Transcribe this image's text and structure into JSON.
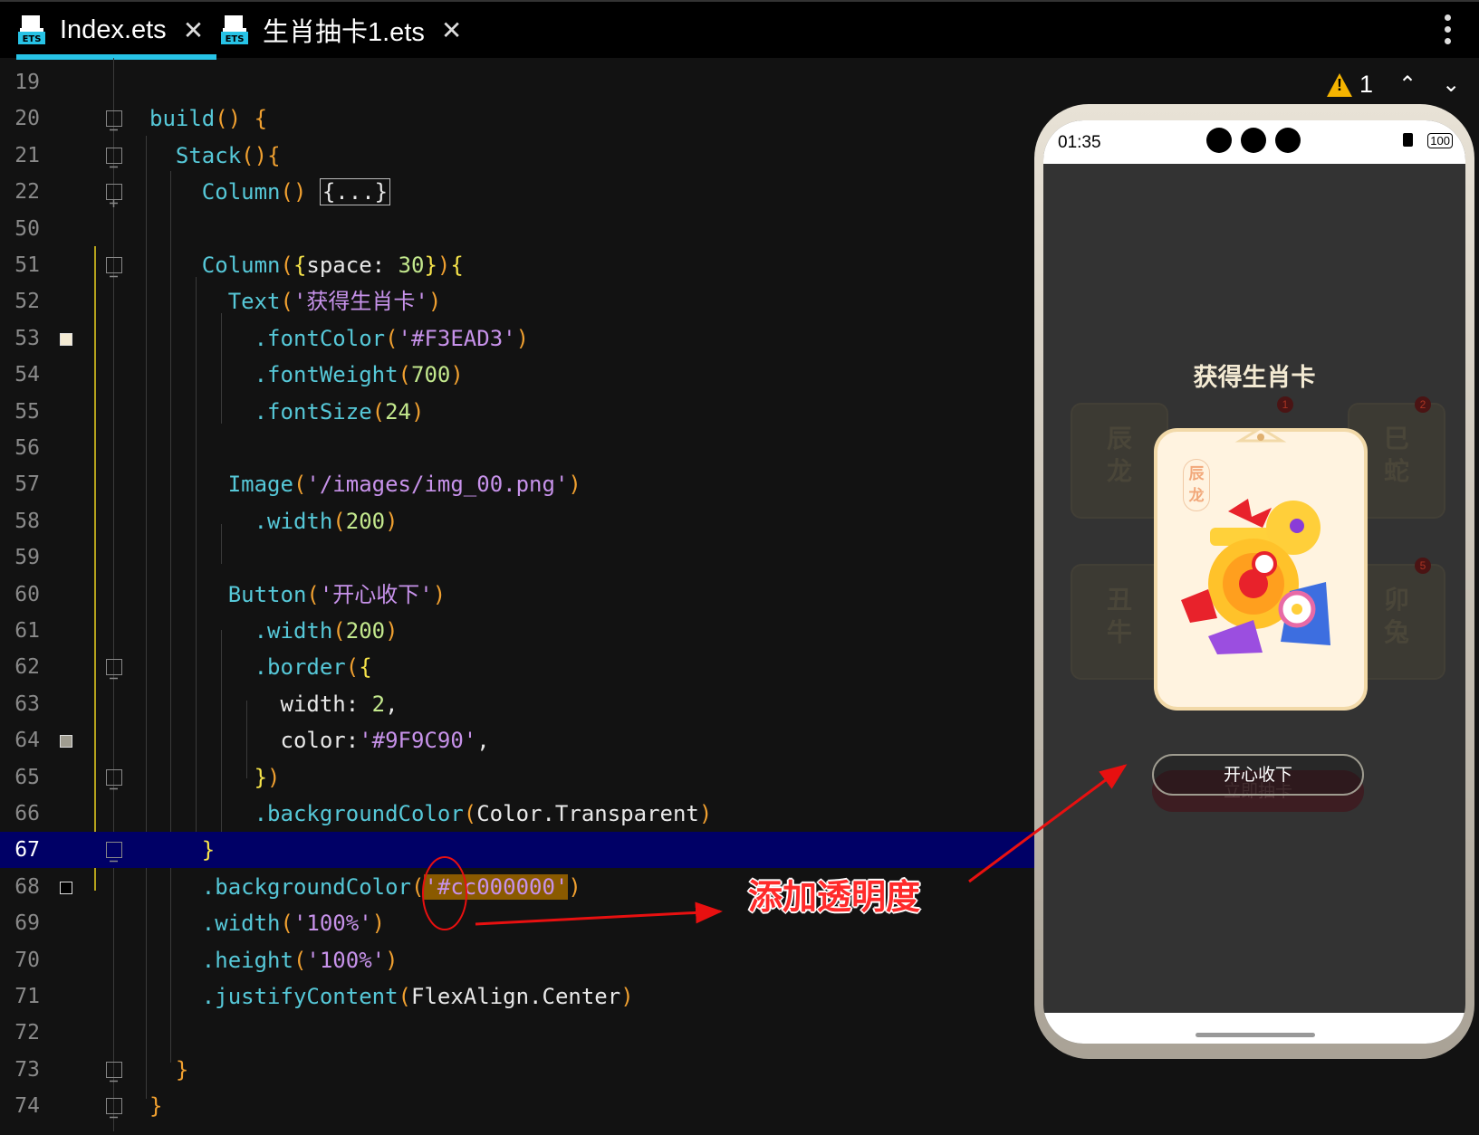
{
  "tabs": [
    {
      "label": "Index.ets",
      "active": true
    },
    {
      "label": "生肖抽卡1.ets",
      "active": false
    }
  ],
  "inspection": {
    "warning_count": "1"
  },
  "code_lines": [
    {
      "num": "19",
      "html": ""
    },
    {
      "num": "20",
      "html": "<span class='fn'>build</span><span class='br'>()</span> <span class='br'>{</span>"
    },
    {
      "num": "21",
      "html": "  <span class='fn'>Stack</span><span class='br'>()</span><span class='br'>{</span>"
    },
    {
      "num": "22",
      "html": "    <span class='fn'>Column</span><span class='br'>()</span> <span class='fold-box'>{...}</span>"
    },
    {
      "num": "50",
      "html": ""
    },
    {
      "num": "51",
      "html": "    <span class='fn'>Column</span><span class='br'>(</span><span class='br2'>{</span>space: <span class='num'>30</span><span class='br2'>}</span><span class='br'>)</span><span class='br2'>{</span>"
    },
    {
      "num": "52",
      "html": "      <span class='fn'>Text</span><span class='br'>(</span><span class='str'>'获得生肖卡'</span><span class='br'>)</span>"
    },
    {
      "num": "53",
      "html": "        <span class='fn'>.fontColor</span><span class='br'>(</span><span class='str'>'#F3EAD3'</span><span class='br'>)</span>"
    },
    {
      "num": "54",
      "html": "        <span class='fn'>.fontWeight</span><span class='br'>(</span><span class='num'>700</span><span class='br'>)</span>"
    },
    {
      "num": "55",
      "html": "        <span class='fn'>.fontSize</span><span class='br'>(</span><span class='num'>24</span><span class='br'>)</span>"
    },
    {
      "num": "56",
      "html": ""
    },
    {
      "num": "57",
      "html": "      <span class='fn'>Image</span><span class='br'>(</span><span class='str'>'/images/img_00.png'</span><span class='br'>)</span>"
    },
    {
      "num": "58",
      "html": "        <span class='fn'>.width</span><span class='br'>(</span><span class='num'>200</span><span class='br'>)</span>"
    },
    {
      "num": "59",
      "html": ""
    },
    {
      "num": "60",
      "html": "      <span class='fn'>Button</span><span class='br'>(</span><span class='str'>'开心收下'</span><span class='br'>)</span>"
    },
    {
      "num": "61",
      "html": "        <span class='fn'>.width</span><span class='br'>(</span><span class='num'>200</span><span class='br'>)</span>"
    },
    {
      "num": "62",
      "html": "        <span class='fn'>.border</span><span class='br'>(</span><span class='br2'>{</span>"
    },
    {
      "num": "63",
      "html": "          width: <span class='num'>2</span>,"
    },
    {
      "num": "64",
      "html": "          color:<span class='str'>'#9F9C90'</span>,"
    },
    {
      "num": "65",
      "html": "        <span class='br2'>}</span><span class='br'>)</span>"
    },
    {
      "num": "66",
      "html": "        <span class='fn'>.backgroundColor</span><span class='br'>(</span>Color.Transparent<span class='br'>)</span>"
    },
    {
      "num": "67",
      "html": "    <span class='br2'>}</span>"
    },
    {
      "num": "68",
      "html": "    <span class='fn'>.backgroundColor</span><span class='br'>(</span><span class='hlstr'><span class='str'>'#cc000000'</span></span><span class='br'>)</span>"
    },
    {
      "num": "69",
      "html": "    <span class='fn'>.width</span><span class='br'>(</span><span class='str'>'100%'</span><span class='br'>)</span>"
    },
    {
      "num": "70",
      "html": "    <span class='fn'>.height</span><span class='br'>(</span><span class='str'>'100%'</span><span class='br'>)</span>"
    },
    {
      "num": "71",
      "html": "    <span class='fn'>.justifyContent</span><span class='br'>(</span>FlexAlign.Center<span class='br'>)</span>"
    },
    {
      "num": "72",
      "html": ""
    },
    {
      "num": "73",
      "html": "  <span class='br'>}</span>"
    },
    {
      "num": "74",
      "html": "<span class='br'>}</span>"
    }
  ],
  "highlighted_line": "67",
  "phone": {
    "time": "01:35",
    "battery": "100",
    "title": "获得生肖卡",
    "card_seal": "辰龙",
    "button_label": "开心收下",
    "ghost_button_label": "立即抽卡",
    "ghost_cards": [
      {
        "text": "辰龙",
        "badge": "1"
      },
      {
        "text": "巳蛇",
        "badge": "2"
      },
      {
        "text": "丑牛",
        "badge": ""
      },
      {
        "text": "卯兔",
        "badge": "5"
      }
    ]
  },
  "annotation": {
    "text": "添加透明度"
  },
  "colors": {
    "accent_tab": "#27c3e6",
    "highlight_line": "#000066",
    "annotation": "#ff2a2a",
    "title_text": "#F3EAD3",
    "button_border": "#9F9C90"
  }
}
